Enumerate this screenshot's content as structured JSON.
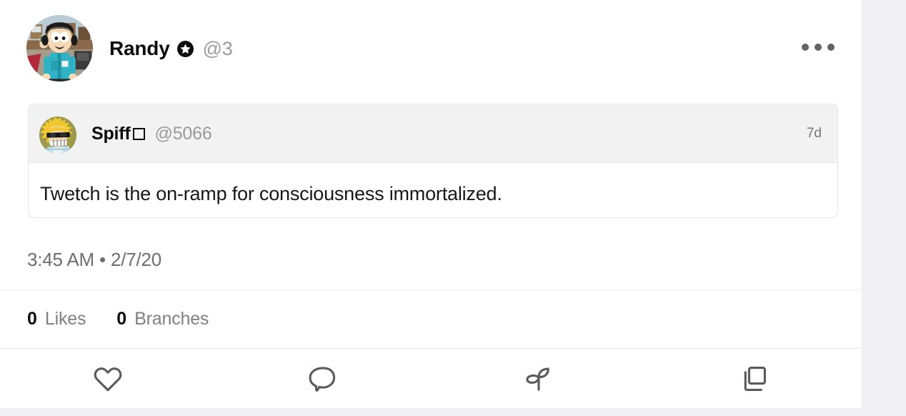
{
  "post": {
    "author": {
      "display_name": "Randy",
      "handle": "@3",
      "verified_badge_icon": "star-badge-icon",
      "avatar_alt": "randy-avatar"
    },
    "more_menu_icon": "more-horizontal-icon",
    "timestamp": "3:45 AM • 2/7/20",
    "quote": {
      "author_name": "Spiff",
      "author_name_suffix_glyph": "□",
      "handle": "@5066",
      "age": "7d",
      "text": "Twetch is the on-ramp for consciousness immortalized.",
      "avatar_alt": "spiff-avatar"
    },
    "stats": [
      {
        "count": "0",
        "label": "Likes",
        "name": "likes"
      },
      {
        "count": "0",
        "label": "Branches",
        "name": "branches"
      }
    ],
    "actions": [
      {
        "icon": "heart-icon",
        "name": "like-button"
      },
      {
        "icon": "comment-bubble-icon",
        "name": "comment-button"
      },
      {
        "icon": "sprout-icon",
        "name": "branch-button"
      },
      {
        "icon": "copy-icon",
        "name": "copy-button"
      }
    ]
  },
  "colors": {
    "page_background": "#f0f0f2",
    "card_background": "#ffffff",
    "quote_header_background": "#f2f2f2",
    "primary_text": "#0d0d0d",
    "muted_text": "#9b9b9b",
    "divider": "#eaeaea",
    "icon_stroke": "#5a5a5a"
  }
}
